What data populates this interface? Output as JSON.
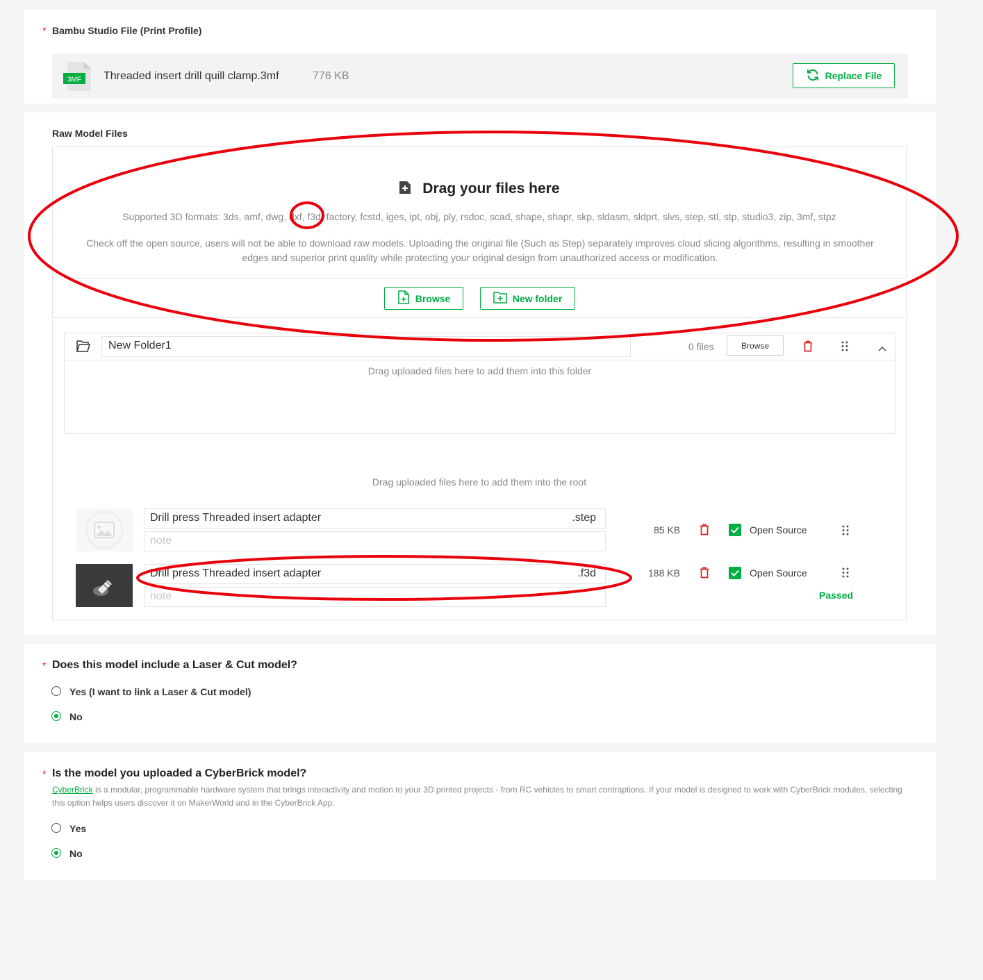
{
  "profile": {
    "label": "Bambu Studio File (Print Profile)",
    "file_badge": "3MF",
    "file_name": "Threaded insert drill quill clamp.3mf",
    "file_size": "776 KB",
    "replace_label": "Replace File"
  },
  "raw": {
    "label": "Raw Model Files",
    "drag_title": "Drag your files here",
    "formats": "Supported 3D formats: 3ds, amf, dwg, dxf, f3d, factory, fcstd, iges, ipt, obj, ply, rsdoc, scad, shape, shapr, skp, sldasm, sldprt, slvs, step, stl, stp, studio3, zip, 3mf, stpz",
    "hint": "Check off the open source, users will not be able to download raw models. Uploading the original file (Such as Step) separately improves cloud slicing algorithms, resulting in smoother edges and superior print quality while protecting your original design from unauthorized access or modification.",
    "browse_label": "Browse",
    "new_folder_label": "New folder",
    "folder": {
      "name": "New Folder1",
      "count": "0 files",
      "browse_label": "Browse",
      "drop_hint": "Drag uploaded files here to add them into this folder"
    },
    "root_hint": "Drag uploaded files here to add them into the root",
    "files": [
      {
        "name": "Drill press Threaded insert adapter",
        "ext": ".step",
        "note_placeholder": "note",
        "size": "85 KB",
        "open_source": "Open Source"
      },
      {
        "name": "Drill press Threaded insert adapter",
        "ext": ".f3d",
        "note_placeholder": "note",
        "size": "188 KB",
        "open_source": "Open Source",
        "status": "Passed"
      }
    ]
  },
  "laser": {
    "question": "Does this model include a Laser & Cut model?",
    "options": [
      "Yes (I want to link a Laser & Cut model)",
      "No"
    ],
    "selected": "No"
  },
  "cyber": {
    "question": "Is the model you uploaded a CyberBrick model?",
    "link_text": "CyberBrick",
    "description": " is a modular, programmable hardware system that brings interactivity and motion to your 3D printed projects - from RC vehicles to smart contraptions. If your model is designed to work with CyberBrick modules, selecting this option helps users discover it on MakerWorld and in the CyberBrick App.",
    "options": [
      "Yes",
      "No"
    ],
    "selected": "No"
  },
  "colors": {
    "accent": "#00ae42",
    "required": "#e02020",
    "annotation": "#e8000b",
    "delete": "#e02020"
  }
}
